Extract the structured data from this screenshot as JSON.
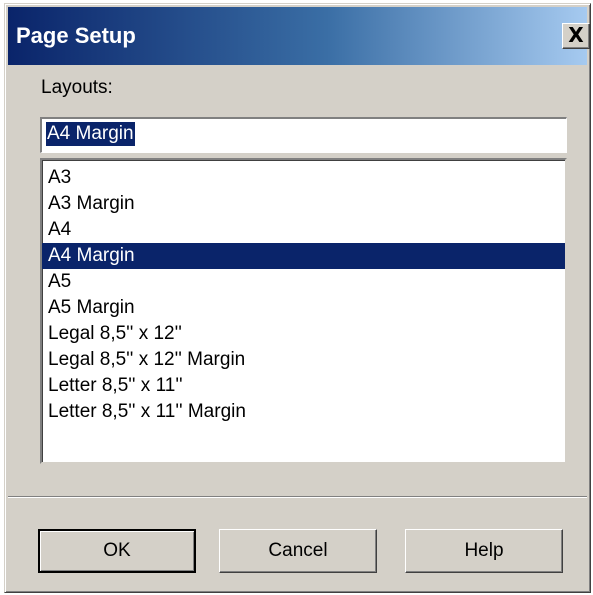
{
  "window": {
    "title": "Page Setup",
    "close_label": "X"
  },
  "layouts": {
    "label": "Layouts:",
    "input_value": "A4 Margin",
    "items": [
      {
        "label": "A3",
        "selected": false
      },
      {
        "label": "A3 Margin",
        "selected": false
      },
      {
        "label": "A4",
        "selected": false
      },
      {
        "label": "A4 Margin",
        "selected": true
      },
      {
        "label": "A5",
        "selected": false
      },
      {
        "label": "A5 Margin",
        "selected": false
      },
      {
        "label": "Legal 8,5'' x 12''",
        "selected": false
      },
      {
        "label": "Legal 8,5'' x 12'' Margin",
        "selected": false
      },
      {
        "label": "Letter 8,5'' x 11''",
        "selected": false
      },
      {
        "label": "Letter 8,5'' x 11'' Margin",
        "selected": false
      }
    ]
  },
  "buttons": {
    "ok": "OK",
    "cancel": "Cancel",
    "help": "Help"
  },
  "colors": {
    "dialog_face": "#d4d0c8",
    "title_start": "#0a246a",
    "title_end": "#a6caf0",
    "selection": "#0a246a"
  }
}
